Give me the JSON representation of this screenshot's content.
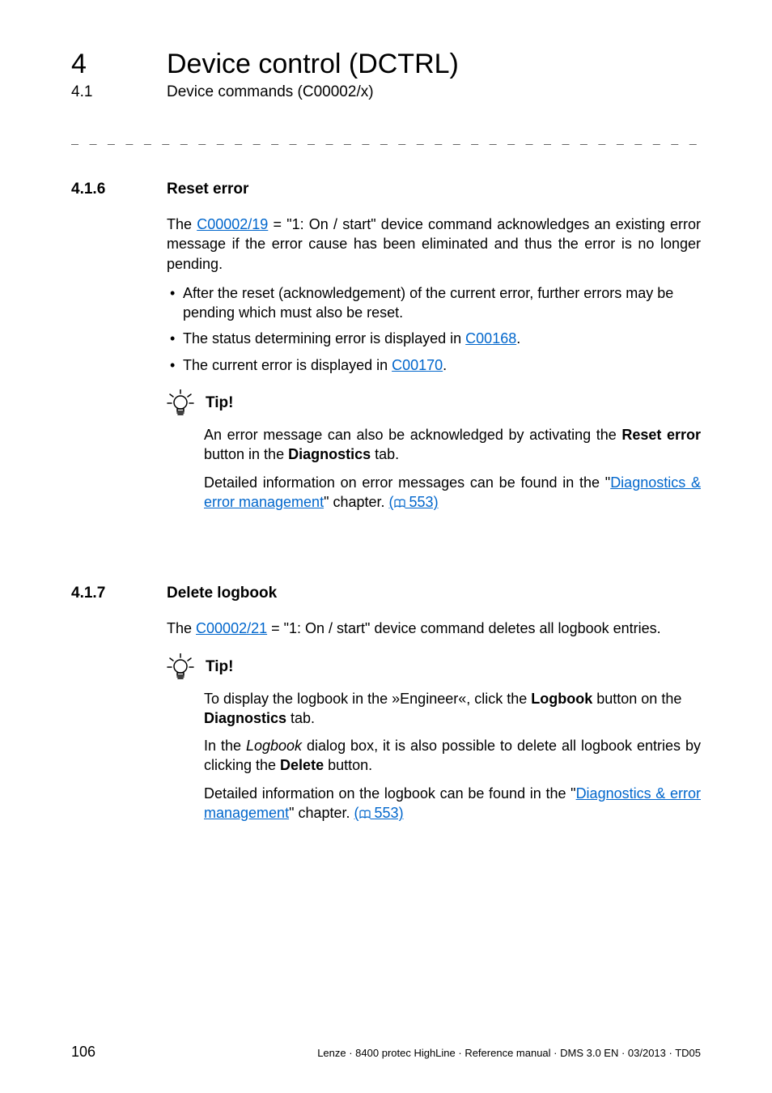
{
  "header": {
    "num": "4",
    "title": "Device control (DCTRL)"
  },
  "subheader": {
    "num": "4.1",
    "title": "Device commands (C00002/x)"
  },
  "dashline": "_ _ _ _ _ _ _ _ _ _ _ _ _ _ _ _ _ _ _ _ _ _ _ _ _ _ _ _ _ _ _ _ _ _ _ _ _ _ _ _ _ _ _ _ _ _ _ _ _ _ _ _ _ _ _ _ _ _ _ _ _ _ _ _",
  "sections": {
    "s1": {
      "num": "4.1.6",
      "title": "Reset error",
      "para1_a": "The ",
      "para1_link": "C00002/19",
      "para1_b": " = \"1: On / start\" device command acknowledges an existing error message if the error cause has been eliminated and thus the error is no longer pending.",
      "bullets": {
        "b1": "After the reset (acknowledgement) of the current error, further errors may be pending which must also be reset.",
        "b2_a": "The status determining error is displayed in ",
        "b2_link": "C00168",
        "b2_b": ".",
        "b3_a": "The current error is displayed in ",
        "b3_link": "C00170",
        "b3_b": "."
      },
      "tip": {
        "label": "Tip!",
        "p1_a": "An error message can also be acknowledged by activating the ",
        "p1_bold": "Reset error",
        "p1_b": " button in the ",
        "p1_bold2": "Diagnostics",
        "p1_c": " tab.",
        "p2_a": "Detailed information on error messages can be found in the \"",
        "p2_link": "Diagnostics & error management",
        "p2_b": "\" chapter. ",
        "p2_ref": "553)"
      }
    },
    "s2": {
      "num": "4.1.7",
      "title": "Delete logbook",
      "para1_a": "The ",
      "para1_link": "C00002/21",
      "para1_b": " = \"1: On / start\" device command deletes all logbook entries.",
      "tip": {
        "label": "Tip!",
        "p1_a": "To display the logbook in the »Engineer«, click the ",
        "p1_bold": "Logbook",
        "p1_b": " button on the ",
        "p1_bold2": "Diagnostics",
        "p1_c": " tab.",
        "p2_a": "In the ",
        "p2_italic": "Logbook",
        "p2_b": " dialog box, it is also possible to delete all logbook entries by clicking the ",
        "p2_bold": "Delete",
        "p2_c": " button.",
        "p3_a": "Detailed information on the logbook can be found in the \"",
        "p3_link": "Diagnostics & error management",
        "p3_b": "\" chapter. ",
        "p3_ref": "553)"
      }
    }
  },
  "footer": {
    "page": "106",
    "text": "Lenze · 8400 protec HighLine · Reference manual · DMS 3.0 EN · 03/2013 · TD05"
  }
}
